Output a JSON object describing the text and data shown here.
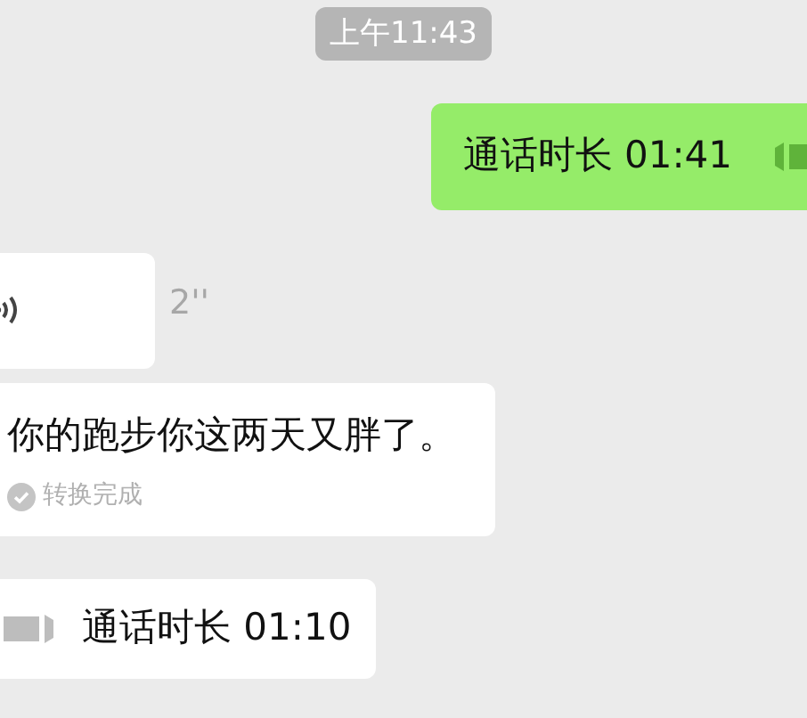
{
  "timestamp": "上午11:43",
  "messages": [
    {
      "kind": "call",
      "outgoing": true,
      "text": "通话时长 01:41"
    },
    {
      "kind": "voice",
      "outgoing": false,
      "duration": "2''"
    },
    {
      "kind": "transcript",
      "outgoing": false,
      "text": "你的跑步你这两天又胖了。",
      "status": "转换完成"
    },
    {
      "kind": "call",
      "outgoing": false,
      "text": "通话时长 01:10"
    }
  ]
}
